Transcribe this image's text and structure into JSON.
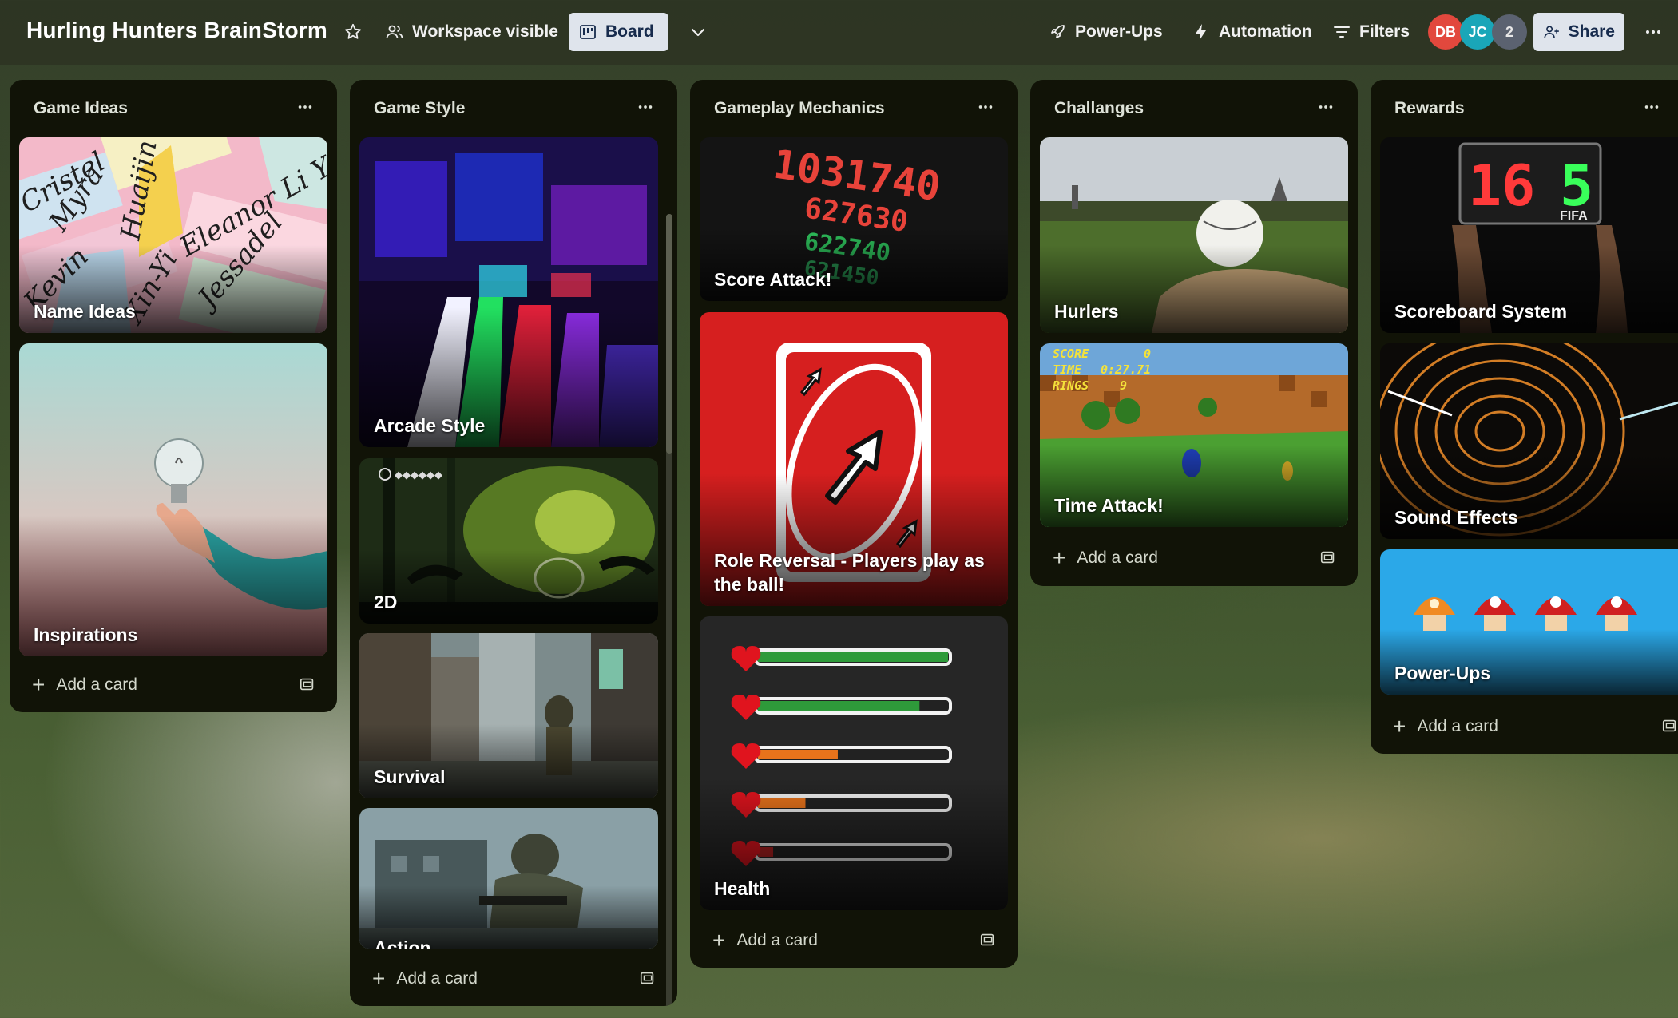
{
  "header": {
    "board_title": "Hurling Hunters BrainStorm",
    "visibility_label": "Workspace visible",
    "view_label": "Board",
    "powerups_label": "Power-Ups",
    "automation_label": "Automation",
    "filters_label": "Filters",
    "members": [
      {
        "initials": "DB",
        "color": "#e2483d"
      },
      {
        "initials": "JC",
        "color": "#1aa6b8"
      }
    ],
    "extra_members": "2",
    "share_label": "Share"
  },
  "lists": [
    {
      "title": "Game Ideas",
      "cards": [
        "Name Ideas",
        "Inspirations"
      ],
      "add_label": "Add a card"
    },
    {
      "title": "Game Style",
      "cards": [
        "Arcade Style",
        "2D",
        "Survival",
        "Action"
      ],
      "add_label": "Add a card"
    },
    {
      "title": "Gameplay Mechanics",
      "cards": [
        "Score Attack!",
        "Role Reversal - Players play as the ball!",
        "Health"
      ],
      "add_label": "Add a card"
    },
    {
      "title": "Challanges",
      "cards": [
        "Hurlers",
        "Time Attack!"
      ],
      "add_label": "Add a card"
    },
    {
      "title": "Rewards",
      "cards": [
        "Scoreboard System",
        "Sound Effects",
        "Power-Ups"
      ],
      "add_label": "Add a card"
    }
  ],
  "card_art": {
    "score_attack_numbers": [
      "1031740",
      "627630",
      "622740",
      "621450"
    ],
    "time_attack_hud": [
      "SCORE",
      "0",
      "TIME",
      "0:27.71",
      "RINGS",
      "9"
    ],
    "scoreboard_digits": [
      "16",
      "5"
    ],
    "scoreboard_brand": "FIFA"
  },
  "health_levels": [
    1.0,
    0.85,
    0.42,
    0.25,
    0.08
  ],
  "colors": {
    "accent": "#dfe4ec",
    "list_bg": "#111307",
    "uno_red": "#d61f1f",
    "health_green": "#2e9a3a",
    "health_orange": "#e8731b"
  }
}
